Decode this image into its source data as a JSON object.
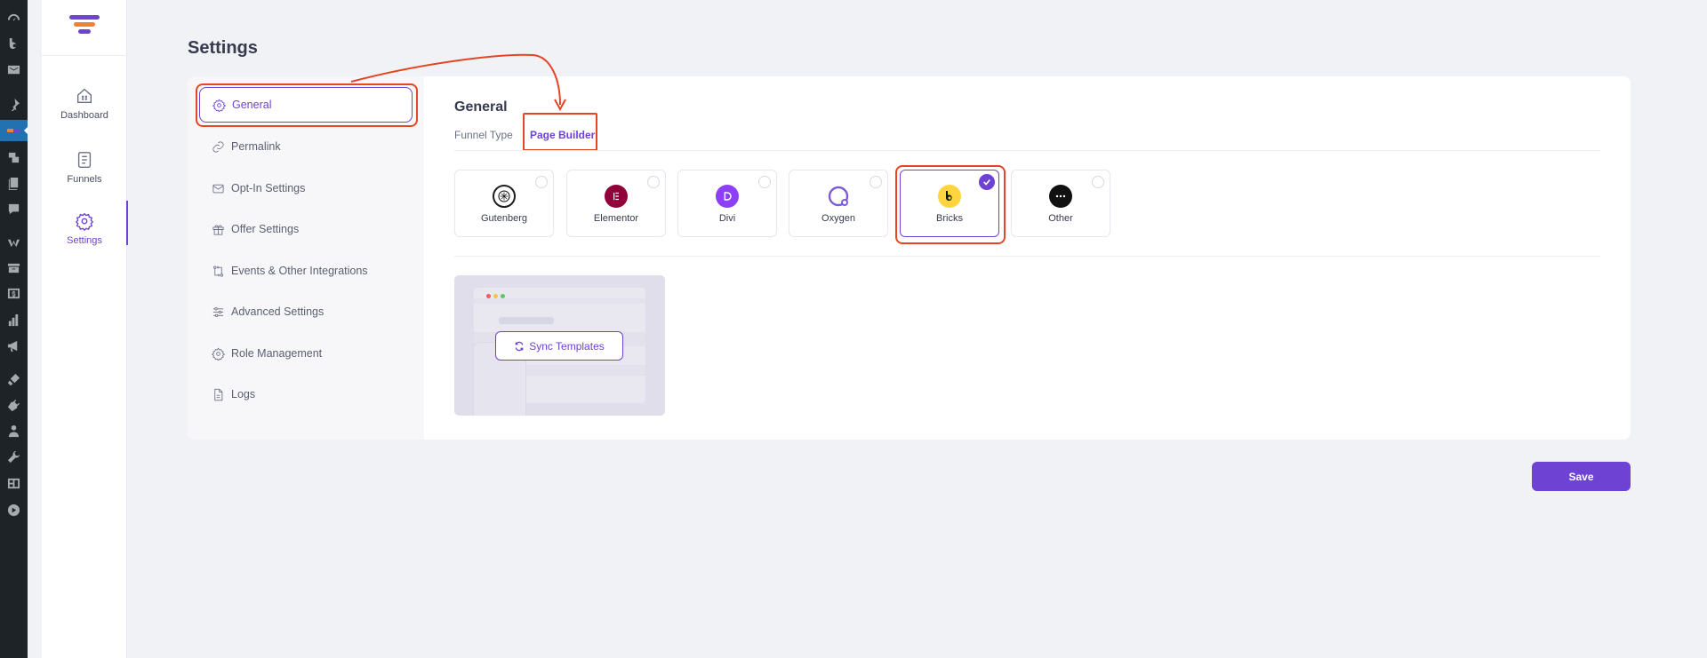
{
  "wp_sidebar": {
    "icons": [
      "dashboard-icon",
      "bricks-icon",
      "mail-icon",
      "pin-icon",
      "funnel-plugin-icon",
      "media-icon",
      "pages-icon",
      "comments-icon",
      "woocommerce-icon",
      "products-icon",
      "payments-icon",
      "analytics-icon",
      "marketing-icon",
      "appearance-icon",
      "plugins-icon",
      "users-icon",
      "tools-icon",
      "settings-icon",
      "play-icon"
    ]
  },
  "app_nav": {
    "items": [
      {
        "label": "Dashboard",
        "icon": "home-icon"
      },
      {
        "label": "Funnels",
        "icon": "document-icon"
      },
      {
        "label": "Settings",
        "icon": "gear-icon",
        "active": true
      }
    ]
  },
  "page": {
    "title": "Settings"
  },
  "settings_menu": {
    "items": [
      {
        "label": "General",
        "icon": "gear-icon",
        "active": true
      },
      {
        "label": "Permalink",
        "icon": "link-icon"
      },
      {
        "label": "Opt-In Settings",
        "icon": "mail-icon"
      },
      {
        "label": "Offer Settings",
        "icon": "gift-icon"
      },
      {
        "label": "Events & Other Integrations",
        "icon": "integration-icon"
      },
      {
        "label": "Advanced Settings",
        "icon": "sliders-icon"
      },
      {
        "label": "Role Management",
        "icon": "user-gear-icon"
      },
      {
        "label": "Logs",
        "icon": "file-icon"
      }
    ]
  },
  "general": {
    "title": "General",
    "tabs": [
      {
        "label": "Funnel Type"
      },
      {
        "label": "Page Builder",
        "active": true
      }
    ],
    "builders": [
      {
        "label": "Gutenberg",
        "icon": "gutenberg-icon",
        "color": "#1e1e1e"
      },
      {
        "label": "Elementor",
        "icon": "elementor-icon",
        "color": "#92003b"
      },
      {
        "label": "Divi",
        "icon": "divi-icon",
        "color": "#8c3ff6"
      },
      {
        "label": "Oxygen",
        "icon": "oxygen-icon",
        "color": "#7b5bd8"
      },
      {
        "label": "Bricks",
        "icon": "bricks-icon",
        "color": "#ffd53e",
        "selected": true
      },
      {
        "label": "Other",
        "icon": "more-icon",
        "color": "#111111"
      }
    ],
    "sync_button": "Sync Templates"
  },
  "footer": {
    "save_label": "Save"
  },
  "colors": {
    "accent": "#6e42d3",
    "highlight": "#e54524",
    "orange": "#ee8134"
  }
}
